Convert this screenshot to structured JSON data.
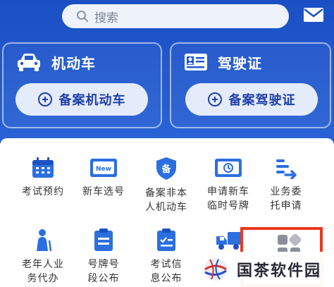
{
  "search": {
    "placeholder": "搜索"
  },
  "cards": [
    {
      "title": "机动车",
      "button": "备案机动车"
    },
    {
      "title": "驾驶证",
      "button": "备案驾驶证"
    }
  ],
  "services": [
    {
      "label": "考试预约"
    },
    {
      "label": "新车选号",
      "badge": "New"
    },
    {
      "label": "备案非本人机动车",
      "badge": "备"
    },
    {
      "label": "申请新车临时号牌"
    },
    {
      "label": "业务委托申请"
    },
    {
      "label": "老年人业务代办"
    },
    {
      "label": "号牌号段公布"
    },
    {
      "label": "考试信息公布"
    }
  ],
  "watermark": {
    "text": "国茶软件园"
  },
  "colors": {
    "primary": "#1d52c8",
    "icon": "#2c6fe0",
    "highlight": "#e9391f"
  }
}
